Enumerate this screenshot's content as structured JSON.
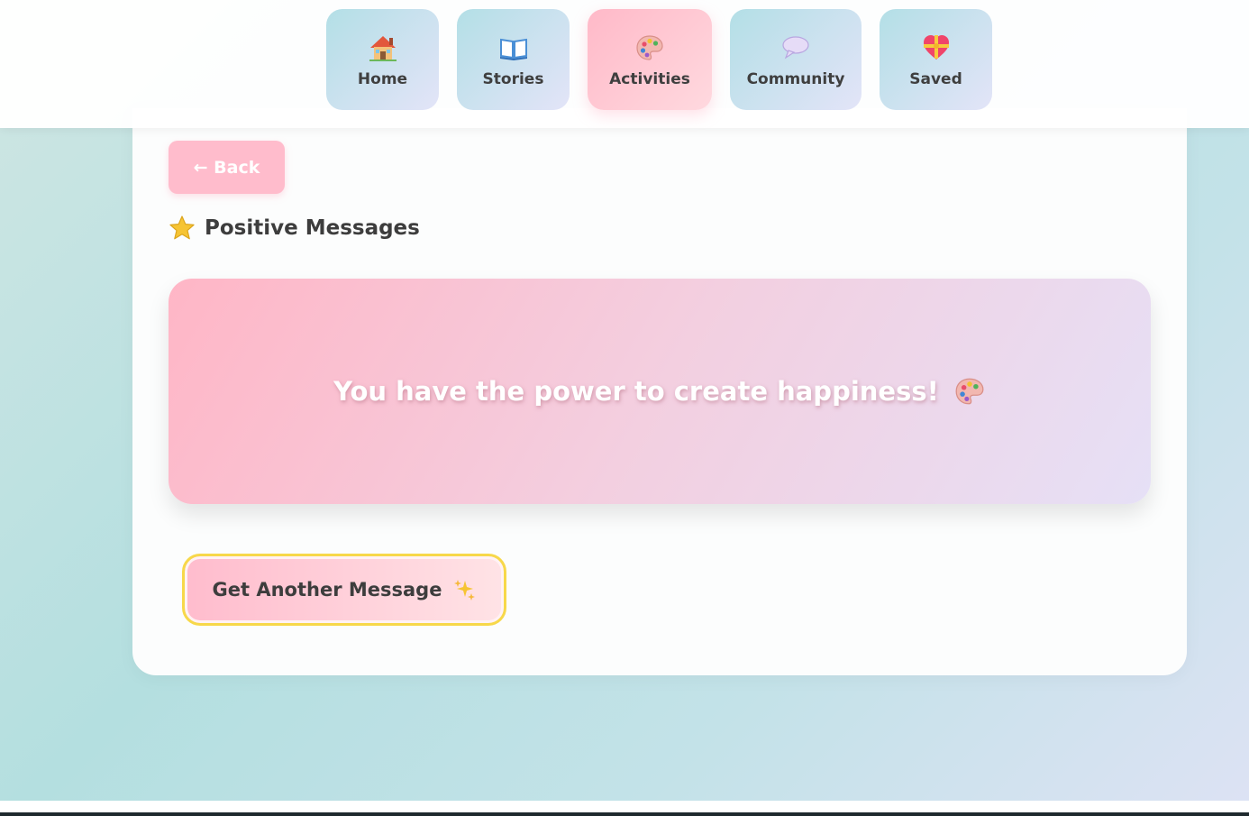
{
  "nav": {
    "items": [
      {
        "label": "Home",
        "icon": "house-icon"
      },
      {
        "label": "Stories",
        "icon": "open-book-icon"
      },
      {
        "label": "Activities",
        "icon": "artist-palette-icon",
        "active": true
      },
      {
        "label": "Community",
        "icon": "speech-bubble-icon"
      },
      {
        "label": "Saved",
        "icon": "gift-heart-icon"
      }
    ]
  },
  "page": {
    "back_label": "← Back",
    "title": "Positive Messages",
    "title_icon": "star-icon"
  },
  "message": {
    "text": "You have the power to create happiness!",
    "icon": "artist-palette-icon"
  },
  "actions": {
    "another_label": "Get Another Message",
    "another_icon": "sparkles-icon"
  },
  "colors": {
    "accent_pink": "#ffbccc",
    "nav_gradient_start": "#b3dfe6",
    "nav_gradient_end": "#e3e4f8",
    "button_border": "#f7d84a"
  }
}
